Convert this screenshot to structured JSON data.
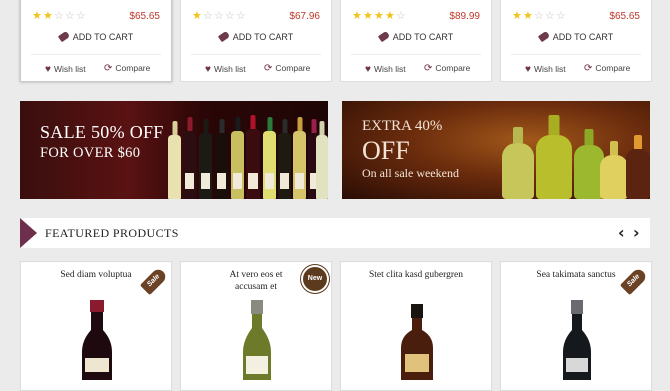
{
  "colors": {
    "accent": "#6d2f4b",
    "price": "#c0392b",
    "star": "#f0c419"
  },
  "top_products": [
    {
      "rating": 2,
      "price": "$65.65",
      "cart_label": "ADD TO CART",
      "wish_label": "Wish list",
      "compare_label": "Compare"
    },
    {
      "rating": 1,
      "price": "$67.96",
      "cart_label": "ADD TO CART",
      "wish_label": "Wish list",
      "compare_label": "Compare"
    },
    {
      "rating": 4,
      "price": "$89.99",
      "cart_label": "ADD TO CART",
      "wish_label": "Wish list",
      "compare_label": "Compare"
    },
    {
      "rating": 2,
      "price": "$65.65",
      "cart_label": "ADD TO CART",
      "wish_label": "Wish list",
      "compare_label": "Compare"
    }
  ],
  "banners": {
    "left": {
      "line1": "SALE 50% OFF",
      "line2": "FOR OVER $60"
    },
    "right": {
      "line1": "EXTRA 40%",
      "line2": "OFF",
      "line3": "On all sale weekend"
    }
  },
  "featured": {
    "title": "FEATURED PRODUCTS",
    "prev_icon": "chevron-left-icon",
    "next_icon": "chevron-right-icon",
    "prev": "‹",
    "next": "›"
  },
  "products": [
    {
      "name": "Sed diam voluptua",
      "badge": "Sale"
    },
    {
      "name": "At vero eos et accusam et",
      "badge": "New"
    },
    {
      "name": "Stet clita kasd gubergren",
      "badge": ""
    },
    {
      "name": "Sea takimata sanctus",
      "badge": "Sale"
    }
  ]
}
